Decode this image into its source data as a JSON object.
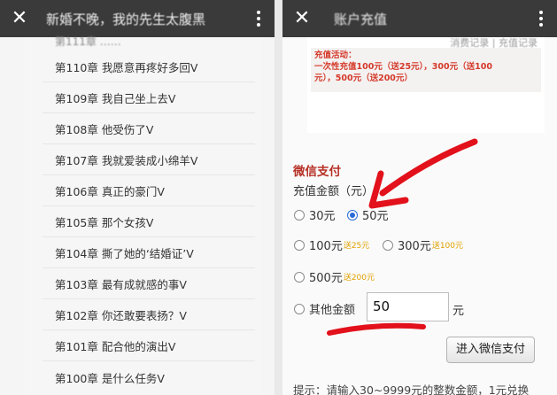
{
  "left": {
    "title": "新婚不晚，我的先生太腹黑",
    "cut_text": "第111章 ……",
    "chapters": [
      "第110章 我愿意再疼好多回V",
      "第109章 我自己坐上去V",
      "第108章 他受伤了V",
      "第107章 我就爱装成小绵羊V",
      "第106章 真正的豪门V",
      "第105章 那个女孩V",
      "第104章 撕了她的‘结婚证’V",
      "第103章 最有成就感的事V",
      "第102章 你还敢要表扬？V",
      "第101章 配合他的演出V",
      "第100章 是什么任务V"
    ]
  },
  "right": {
    "title": "账户充值",
    "promo_header": "消费记录 | 充值记录",
    "promo_lines": [
      "充值活动：",
      "一次性充值100元（送25元），300元（送100",
      "元），500元（送200元）"
    ],
    "pay_title": "微信支付",
    "amount_label": "充值金额（元）",
    "options": [
      {
        "label": "30元",
        "bonus": "",
        "selected": false
      },
      {
        "label": "50元",
        "bonus": "",
        "selected": true
      },
      {
        "label": "100元",
        "bonus": "送25元",
        "selected": false
      },
      {
        "label": "300元",
        "bonus": "送100元",
        "selected": false
      },
      {
        "label": "500元",
        "bonus": "送200元",
        "selected": false
      }
    ],
    "other_label": "其他金额",
    "other_value": "50",
    "unit": "元",
    "pay_button": "进入微信支付",
    "hint": "提示：请输入30~9999元的整数金额，1元兑换"
  },
  "colors": {
    "topbar": "#3a3a3a",
    "accent_red": "#b63026",
    "promo_red": "#d43a2a",
    "bonus_gold": "#e0a100",
    "radio_blue": "#2a6bd6",
    "annotation_red": "#e2111b"
  },
  "icons": [
    "close-icon",
    "more-vertical-icon",
    "radio-button"
  ]
}
